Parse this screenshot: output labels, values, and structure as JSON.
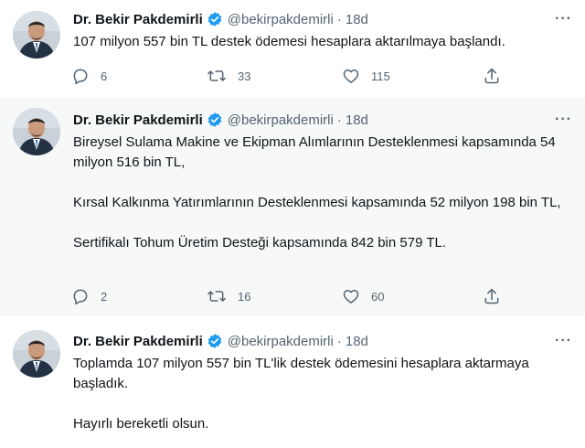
{
  "colors": {
    "accent": "#1d9bf0",
    "muted": "#536471",
    "text": "#0f1419"
  },
  "tweets": [
    {
      "author_name": "Dr. Bekir Pakdemirli",
      "handle": "@bekirpakdemirli",
      "separator": "·",
      "time": "18d",
      "paragraphs": [
        "107 milyon 557 bin TL destek ödemesi hesaplara aktarılmaya başlandı."
      ],
      "replies": "6",
      "retweets": "33",
      "likes": "115"
    },
    {
      "author_name": "Dr. Bekir Pakdemirli",
      "handle": "@bekirpakdemirli",
      "separator": "·",
      "time": "18d",
      "paragraphs": [
        "Bireysel Sulama Makine ve Ekipman Alımlarının Desteklenmesi kapsamında 54 milyon 516 bin TL,",
        "Kırsal Kalkınma Yatırımlarının Desteklenmesi kapsamında 52 milyon 198 bin TL,",
        "Sertifikalı Tohum Üretim Desteği kapsamında 842 bin 579 TL."
      ],
      "replies": "2",
      "retweets": "16",
      "likes": "60"
    },
    {
      "author_name": "Dr. Bekir Pakdemirli",
      "handle": "@bekirpakdemirli",
      "separator": "·",
      "time": "18d",
      "paragraphs": [
        "Toplamda 107 milyon 557 bin TL'lik destek ödemesini hesaplara aktarmaya başladık.",
        "Hayırlı bereketli olsun."
      ]
    }
  ],
  "icons": {
    "more": "more-icon",
    "verified": "verified-badge-icon",
    "reply": "reply-icon",
    "retweet": "retweet-icon",
    "like": "like-icon",
    "share": "share-icon"
  }
}
